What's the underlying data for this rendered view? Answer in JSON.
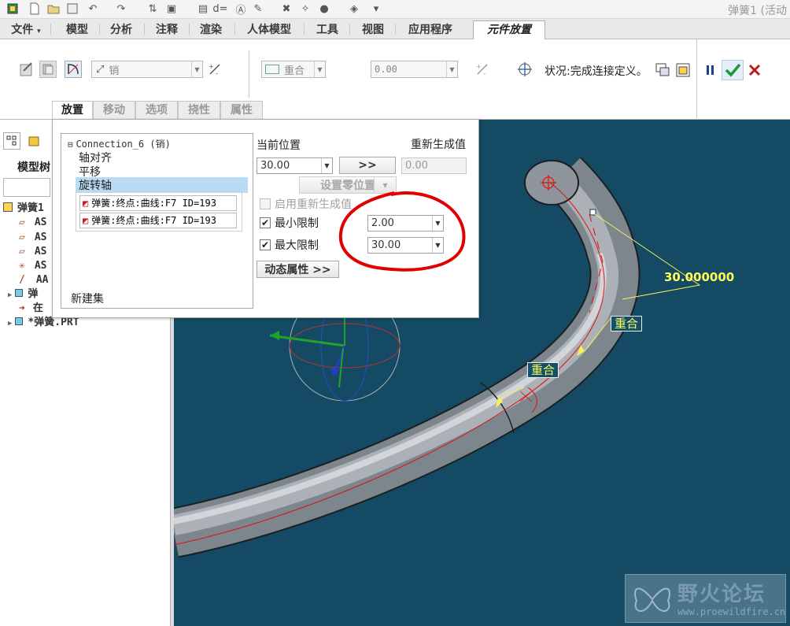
{
  "app": {
    "title": "弹簧1 (活动",
    "ribbon_tabs": [
      "文件",
      "模型",
      "分析",
      "注释",
      "渲染",
      "人体模型",
      "工具",
      "视图",
      "应用程序",
      "元件放置"
    ]
  },
  "ribbon": {
    "connection_type": "销",
    "constraint_type": "重合",
    "offset_value": "0.00",
    "status_text": "状况:完成连接定义。"
  },
  "subtabs": [
    "放置",
    "移动",
    "选项",
    "挠性",
    "属性"
  ],
  "placement": {
    "tree_root": "Connection_6 (销)",
    "items": [
      "轴对齐",
      "平移",
      "旋转轴"
    ],
    "refs": [
      "弹簧:终点:曲线:F7 ID=193",
      "弹簧:终点:曲线:F7 ID=193"
    ],
    "new_set": "新建集",
    "current_position_label": "当前位置",
    "current_position_value": "30.00",
    "go_button": ">>",
    "regen_value_label": "重新生成值",
    "regen_value": "0.00",
    "set_zero_button": "设置零位置",
    "enable_regen_label": "启用重新生成值",
    "min_limit_label": "最小限制",
    "min_limit_value": "2.00",
    "max_limit_label": "最大限制",
    "max_limit_value": "30.00",
    "dynamic_props_button": "动态属性 >>"
  },
  "model_tree": {
    "title": "模型树",
    "items": [
      "弹簧1",
      "AS",
      "AS",
      "AS",
      "AS",
      "AA",
      "弹",
      "在",
      "*弹簧.PRT"
    ]
  },
  "viewport": {
    "dimension": "30.000000",
    "constraint_label_1": "重合",
    "constraint_label_2": "重合",
    "watermark_title": "野火论坛",
    "watermark_url": "www.proewildfire.cn"
  }
}
